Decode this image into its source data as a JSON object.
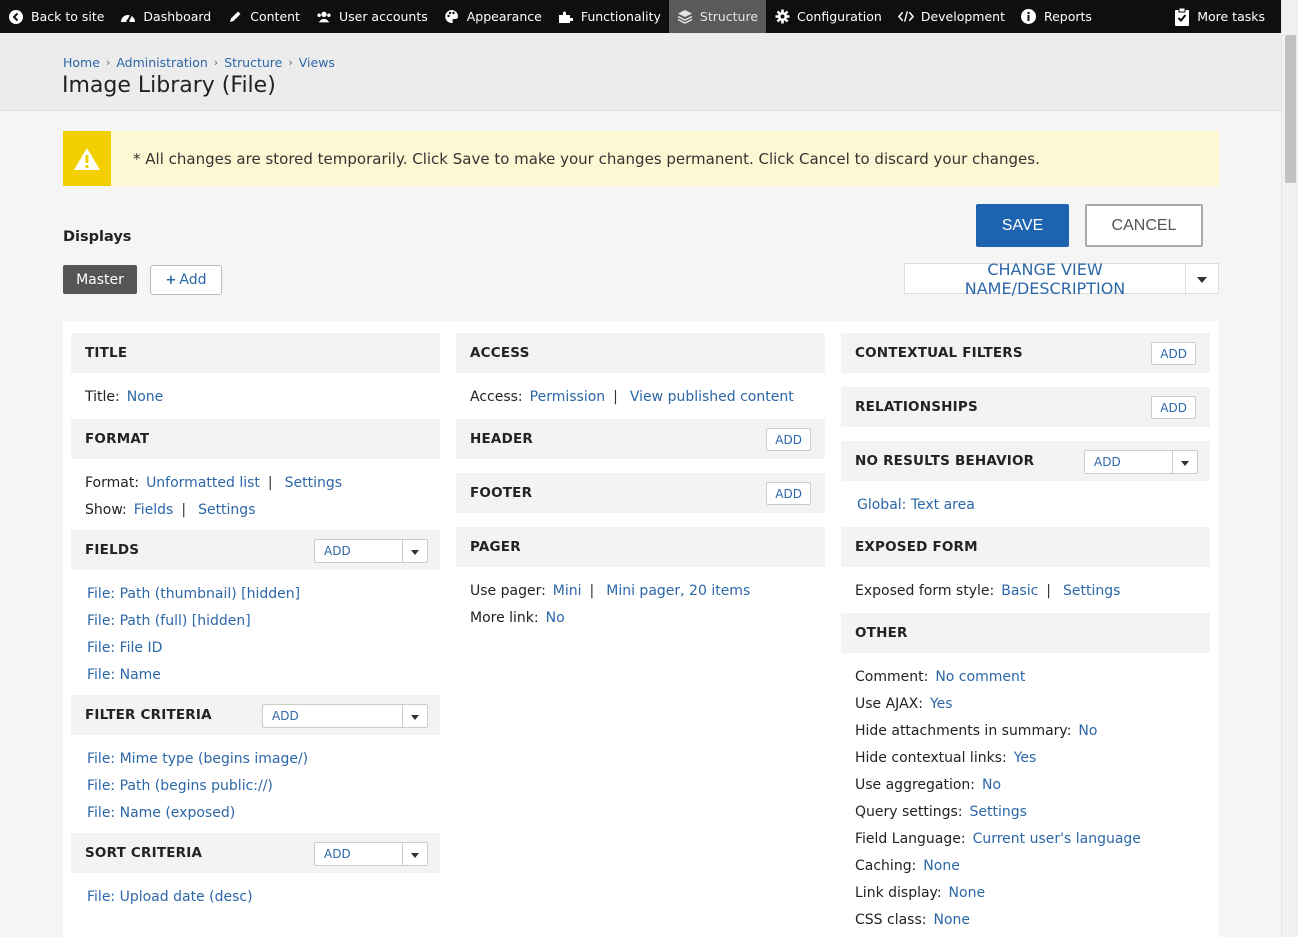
{
  "toolbar": {
    "items": [
      {
        "label": "Back to site",
        "icon": "back-circle-icon"
      },
      {
        "label": "Dashboard",
        "icon": "dashboard-icon"
      },
      {
        "label": "Content",
        "icon": "pencil-icon"
      },
      {
        "label": "User accounts",
        "icon": "users-icon"
      },
      {
        "label": "Appearance",
        "icon": "palette-icon"
      },
      {
        "label": "Functionality",
        "icon": "puzzle-icon"
      },
      {
        "label": "Structure",
        "icon": "layers-icon"
      },
      {
        "label": "Configuration",
        "icon": "gear-icon"
      },
      {
        "label": "Development",
        "icon": "code-icon"
      },
      {
        "label": "Reports",
        "icon": "info-icon"
      }
    ],
    "more_tasks": "More tasks"
  },
  "breadcrumb": [
    "Home",
    "Administration",
    "Structure",
    "Views"
  ],
  "page_title": "Image Library (File)",
  "warning": "* All changes are stored temporarily. Click Save to make your changes permanent. Click Cancel to discard your changes.",
  "displays": {
    "label": "Displays",
    "master_tab": "Master",
    "add_label": "Add",
    "save": "SAVE",
    "cancel": "CANCEL",
    "change_view": "CHANGE VIEW NAME/DESCRIPTION"
  },
  "sections": {
    "title": {
      "heading": "TITLE",
      "label": "Title:",
      "value": "None"
    },
    "format": {
      "heading": "FORMAT",
      "format_label": "Format:",
      "format_value": "Unformatted list",
      "format_settings": "Settings",
      "show_label": "Show:",
      "show_value": "Fields",
      "show_settings": "Settings"
    },
    "fields": {
      "heading": "FIELDS",
      "add": "ADD",
      "items": [
        "File: Path (thumbnail) [hidden]",
        "File: Path (full) [hidden]",
        "File: File ID",
        "File: Name"
      ]
    },
    "filter": {
      "heading": "FILTER CRITERIA",
      "add": "ADD",
      "items": [
        "File: Mime type (begins image/)",
        "File: Path (begins public://)",
        "File: Name (exposed)"
      ]
    },
    "sort": {
      "heading": "SORT CRITERIA",
      "add": "ADD",
      "items": [
        "File: Upload date (desc)"
      ]
    },
    "access": {
      "heading": "ACCESS",
      "label": "Access:",
      "value1": "Permission",
      "value2": "View published content"
    },
    "header": {
      "heading": "HEADER",
      "add": "ADD"
    },
    "footer": {
      "heading": "FOOTER",
      "add": "ADD"
    },
    "pager": {
      "heading": "PAGER",
      "use_label": "Use pager:",
      "use_value1": "Mini",
      "use_value2": "Mini pager, 20 items",
      "more_label": "More link:",
      "more_value": "No"
    },
    "contextual": {
      "heading": "CONTEXTUAL FILTERS",
      "add": "ADD"
    },
    "relationships": {
      "heading": "RELATIONSHIPS",
      "add": "ADD"
    },
    "no_results": {
      "heading": "NO RESULTS BEHAVIOR",
      "add": "ADD",
      "items": [
        "Global: Text area"
      ]
    },
    "exposed": {
      "heading": "EXPOSED FORM",
      "label": "Exposed form style:",
      "value": "Basic",
      "settings": "Settings"
    },
    "other": {
      "heading": "OTHER",
      "rows": [
        {
          "label": "Comment:",
          "value": "No comment"
        },
        {
          "label": "Use AJAX:",
          "value": "Yes"
        },
        {
          "label": "Hide attachments in summary:",
          "value": "No"
        },
        {
          "label": "Hide contextual links:",
          "value": "Yes"
        },
        {
          "label": "Use aggregation:",
          "value": "No"
        },
        {
          "label": "Query settings:",
          "value": "Settings"
        },
        {
          "label": "Field Language:",
          "value": "Current user's language"
        },
        {
          "label": "Caching:",
          "value": "None"
        },
        {
          "label": "Link display:",
          "value": "None"
        },
        {
          "label": "CSS class:",
          "value": "None"
        }
      ]
    }
  }
}
